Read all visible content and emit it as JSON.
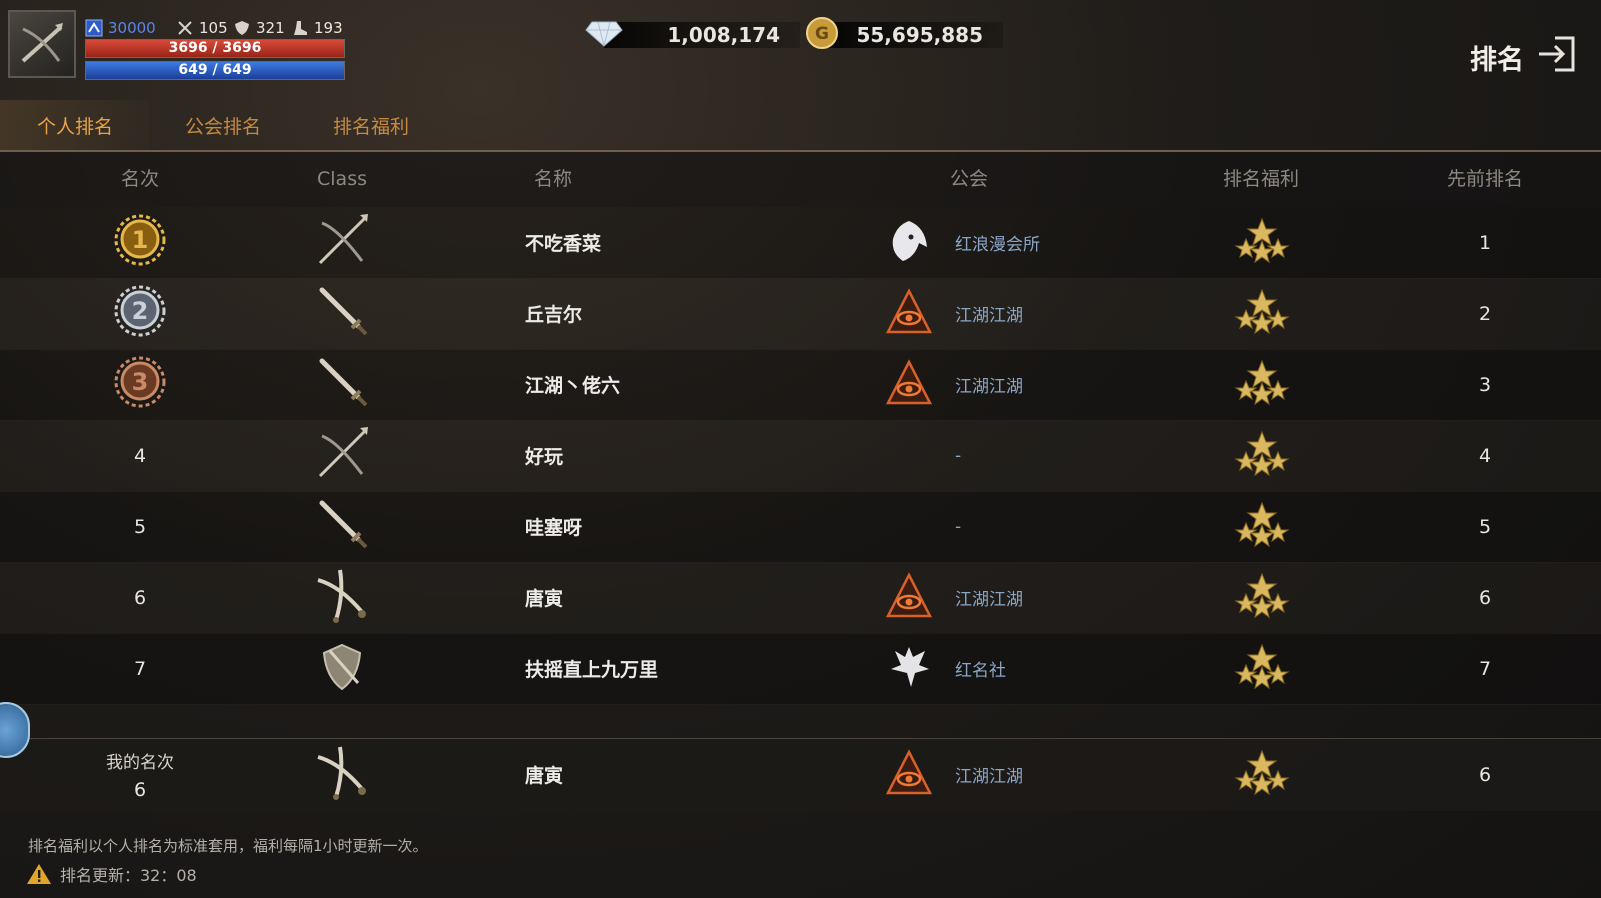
{
  "player": {
    "level_value": "30000",
    "attack": "105",
    "defense": "321",
    "power": "193",
    "hp_text": "3696 / 3696",
    "hp_fraction": 1.0,
    "mp_text": "649 / 649",
    "mp_fraction": 1.0
  },
  "currency": {
    "diamonds": "1,008,174",
    "gold": "55,695,885"
  },
  "header": {
    "title": "排名"
  },
  "tabs": [
    {
      "label": "个人排名",
      "active": true
    },
    {
      "label": "公会排名",
      "active": false
    },
    {
      "label": "排名福利",
      "active": false
    }
  ],
  "columns": {
    "rank": "名次",
    "class": "Class",
    "name": "名称",
    "guild": "公会",
    "benefit": "排名福利",
    "previous": "先前排名"
  },
  "rows": [
    {
      "rank": "1",
      "medal": "gold",
      "class_icon": "bow-icon",
      "name": "不吃香菜",
      "guild_icon": "wolf-emblem-icon",
      "guild": "红浪漫会所",
      "previous": "1"
    },
    {
      "rank": "2",
      "medal": "silver",
      "class_icon": "sword-icon",
      "name": "丘吉尔",
      "guild_icon": "eye-pyramid-emblem-icon",
      "guild": "江湖江湖",
      "previous": "2"
    },
    {
      "rank": "3",
      "medal": "bronze",
      "class_icon": "sword-icon",
      "name": "江湖丶佬六",
      "guild_icon": "eye-pyramid-emblem-icon",
      "guild": "江湖江湖",
      "previous": "3"
    },
    {
      "rank": "4",
      "medal": "",
      "class_icon": "bow-icon",
      "name": "好玩",
      "guild_icon": "",
      "guild": "-",
      "previous": "4"
    },
    {
      "rank": "5",
      "medal": "",
      "class_icon": "sword-icon",
      "name": "哇塞呀",
      "guild_icon": "",
      "guild": "-",
      "previous": "5"
    },
    {
      "rank": "6",
      "medal": "",
      "class_icon": "dual-blades-icon",
      "name": "唐寅",
      "guild_icon": "eye-pyramid-emblem-icon",
      "guild": "江湖江湖",
      "previous": "6"
    },
    {
      "rank": "7",
      "medal": "",
      "class_icon": "shield-icon",
      "name": "扶摇直上九万里",
      "guild_icon": "dragon-emblem-icon",
      "guild": "红名社",
      "previous": "7"
    }
  ],
  "my_rank": {
    "label": "我的名次",
    "rank": "6",
    "class_icon": "dual-blades-icon",
    "name": "唐寅",
    "guild_icon": "eye-pyramid-emblem-icon",
    "guild": "江湖江湖",
    "previous": "6"
  },
  "footer": {
    "note": "排名福利以个人排名为标准套用，福利每隔1小时更新一次。",
    "update_label": "排名更新：32：08"
  },
  "colors": {
    "tab_active": "#e8a347",
    "tab_inactive": "#c58a3e",
    "guild_text": "#8aa6c6",
    "hp": "#c2382a",
    "mp": "#2e5fc4"
  }
}
